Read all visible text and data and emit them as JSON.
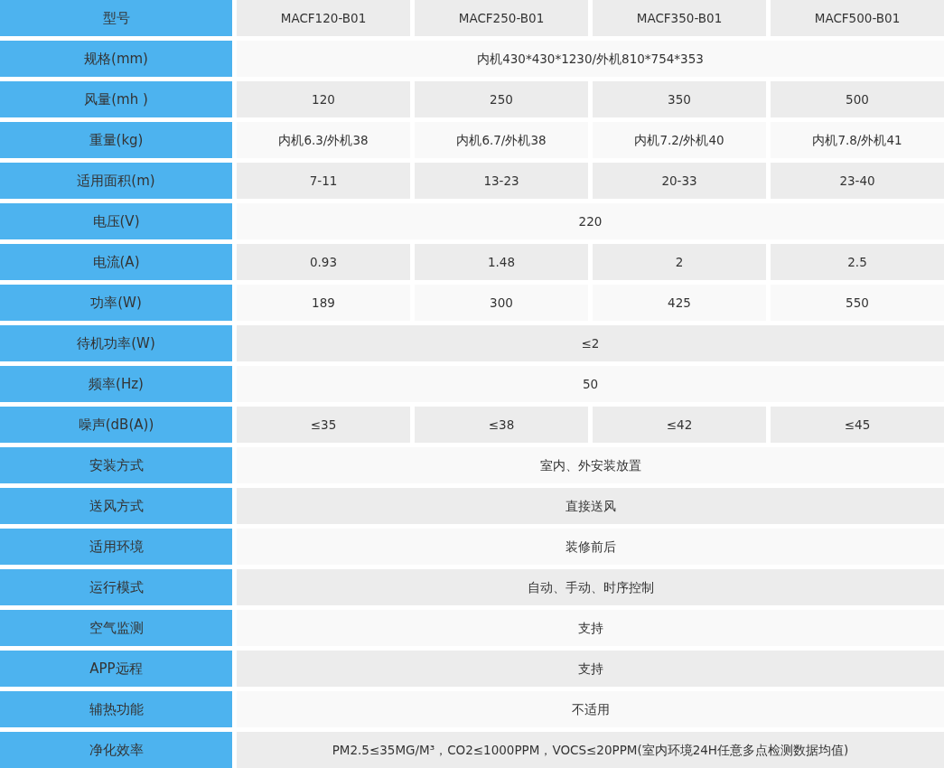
{
  "table": {
    "rows": [
      {
        "label": "型号",
        "values": [
          "MACF120-B01",
          "MACF250-B01",
          "MACF350-B01",
          "MACF500-B01"
        ]
      },
      {
        "label": "规格(mm)",
        "values": [
          "内机430*430*1230/外机810*754*353"
        ]
      },
      {
        "label": "风量(mh )",
        "values": [
          "120",
          "250",
          "350",
          "500"
        ]
      },
      {
        "label": "重量(kg)",
        "values": [
          "内机6.3/外机38",
          "内机6.7/外机38",
          "内机7.2/外机40",
          "内机7.8/外机41"
        ]
      },
      {
        "label": "适用面积(m)",
        "values": [
          "7-11",
          "13-23",
          "20-33",
          "23-40"
        ]
      },
      {
        "label": "电压(V)",
        "values": [
          "220"
        ]
      },
      {
        "label": "电流(A)",
        "values": [
          "0.93",
          "1.48",
          "2",
          "2.5"
        ]
      },
      {
        "label": "功率(W)",
        "values": [
          "189",
          "300",
          "425",
          "550"
        ]
      },
      {
        "label": "待机功率(W)",
        "values": [
          "≤2"
        ]
      },
      {
        "label": "频率(Hz)",
        "values": [
          "50"
        ]
      },
      {
        "label": "噪声(dB(A))",
        "values": [
          "≤35",
          "≤38",
          "≤42",
          "≤45"
        ]
      },
      {
        "label": "安装方式",
        "values": [
          "室内、外安装放置"
        ]
      },
      {
        "label": "送风方式",
        "values": [
          "直接送风"
        ]
      },
      {
        "label": "适用环境",
        "values": [
          "装修前后"
        ]
      },
      {
        "label": "运行模式",
        "values": [
          "自动、手动、时序控制"
        ]
      },
      {
        "label": "空气监测",
        "values": [
          "支持"
        ]
      },
      {
        "label": "APP远程",
        "values": [
          "支持"
        ]
      },
      {
        "label": "辅热功能",
        "values": [
          "不适用"
        ]
      },
      {
        "label": "净化效率",
        "values": [
          "PM2.5≤35MG/M³，CO2≤1000PPM，VOCS≤20PPM(室内环境24H任意多点检测数据均值)"
        ]
      }
    ]
  }
}
